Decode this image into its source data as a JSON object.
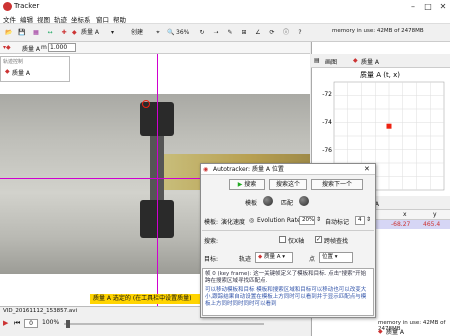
{
  "window": {
    "title": "Tracker"
  },
  "menu": [
    "文件",
    "编辑",
    "视图",
    "轨迹",
    "坐标系",
    "窗口",
    "帮助"
  ],
  "toolbar": {
    "track_label": "质量 A",
    "zoom": "36%",
    "create_label": "创建",
    "memory": "memory in use: 42MB of 2478MB"
  },
  "subbar": {
    "track": "质量 A",
    "mass_label": "m",
    "mass_value": "1.000"
  },
  "track_control": {
    "header": "轨迹控制",
    "item": "质量 A"
  },
  "plot": {
    "header_label": "画图",
    "track": "质量 A",
    "title": "质量 A (t, x)",
    "y_ticks": [
      "-72",
      "-74",
      "-76",
      "-78"
    ],
    "point": {
      "t": 0.0,
      "x": -74.3
    }
  },
  "table": {
    "track": "质量 A",
    "cols": [
      "x",
      "y"
    ],
    "row": [
      "-68.27",
      "465.4"
    ]
  },
  "video": {
    "status": "质量 A 选定的 (在工具栏中设置质量)",
    "filename": "VID_20161112_153857.avi"
  },
  "bottom": {
    "frame": "0",
    "rate": "100%",
    "memory": "memory in use: 42MB of 2478MB",
    "track": "质量 A"
  },
  "autotracker": {
    "title": "Autotracker: 质量 A 位置",
    "search_btn": "搜索",
    "search_this_btn": "搜索这个",
    "search_next_btn": "搜索下一个",
    "template_label": "模板",
    "match_label": "匹配",
    "template_row": "模板:",
    "smoothing": "演化速度",
    "evolution_label": "Evolution Rate",
    "evolution_value": "20%",
    "auto_mark_label": "自动标记",
    "auto_mark_value": "4",
    "search_row": "搜索:",
    "only_x": "仅X轴",
    "look_ahead": "跨帧查找",
    "target_row": "目标:",
    "target_track_label": "轨迹",
    "target_track": "质量 A",
    "target_point_label": "点",
    "target_point": "位置",
    "info_line1": "帧 0 (key frame): 这一关键帧定义了模板和目标. 点击\"搜索\"开始跨在搜索区域寻找匹配点.",
    "info_line2": "可以移动模板和目标 模板和搜索区域和目标可以移动也可以改变大小,跟踪结果自动设置在模板上方同时可以看到并于显示匹配点与模板上方同时同时同时可以看到"
  }
}
